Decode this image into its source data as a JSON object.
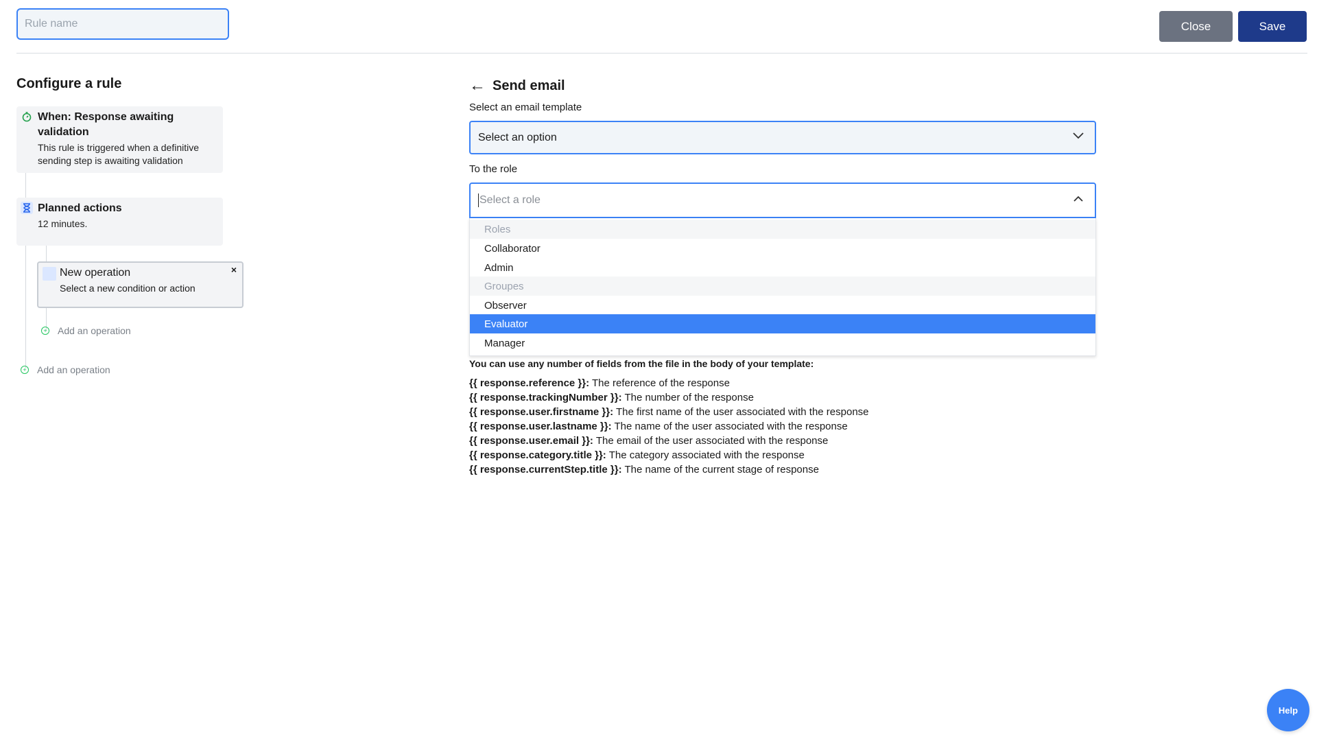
{
  "header": {
    "rule_name_placeholder": "Rule name",
    "close_label": "Close",
    "save_label": "Save"
  },
  "left": {
    "title": "Configure a rule",
    "trigger": {
      "title_line1": "When: Response awaiting",
      "title_line2": "validation",
      "desc_line1": "This rule is triggered when a definitive",
      "desc_line2": "sending step is awaiting validation",
      "icon": "stopwatch-icon"
    },
    "planned": {
      "title": "Planned actions",
      "desc": "12 minutes.",
      "icon": "hourglass-icon"
    },
    "new_operation": {
      "title": "New operation",
      "desc": "Select a new condition or action",
      "close": "×"
    },
    "add_operation_inner": "Add an operation",
    "add_operation_outer": "Add an operation"
  },
  "right": {
    "title": "Send email",
    "template_label": "Select an email template",
    "template_value": "Select an option",
    "role_label": "To the role",
    "role_placeholder": "Select a role",
    "dropdown": [
      {
        "label": "Roles",
        "type": "group"
      },
      {
        "label": "Collaborator",
        "type": "item"
      },
      {
        "label": "Admin",
        "type": "item"
      },
      {
        "label": "Groupes",
        "type": "group"
      },
      {
        "label": "Observer",
        "type": "item"
      },
      {
        "label": "Evaluator",
        "type": "selected"
      },
      {
        "label": "Manager",
        "type": "item"
      }
    ],
    "fields_intro": "You can use any number of fields from the file in the body of your template:",
    "fields": [
      {
        "key": "{{ response.reference }}:",
        "desc": " The reference of the response"
      },
      {
        "key": "{{ response.trackingNumber }}:",
        "desc": " The number of the response"
      },
      {
        "key": "{{ response.user.firstname }}:",
        "desc": " The first name of the user associated with the response"
      },
      {
        "key": "{{ response.user.lastname }}:",
        "desc": " The name of the user associated with the response"
      },
      {
        "key": "{{ response.user.email }}:",
        "desc": " The email of the user associated with the response"
      },
      {
        "key": "{{ response.category.title }}:",
        "desc": " The category associated with the response"
      },
      {
        "key": "{{ response.currentStep.title }}:",
        "desc": " The name of the current stage of response"
      }
    ]
  },
  "help_label": "Help",
  "colors": {
    "accent": "#3b82f6",
    "save": "#1e3a8a",
    "close": "#6b7280",
    "add": "#22c55e"
  }
}
